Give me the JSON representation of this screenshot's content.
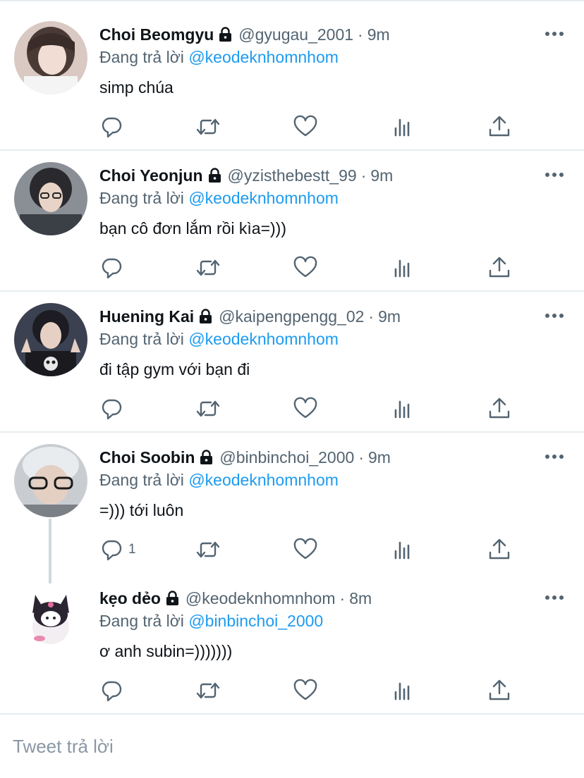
{
  "tweets": [
    {
      "name": "Choi Beomgyu",
      "handle": "@gyugau_2001",
      "time": "9m",
      "reply_prefix": "Đang trả lời",
      "reply_to": "@keodeknhomnhom",
      "text": "simp chúa",
      "reply_count": ""
    },
    {
      "name": "Choi Yeonjun",
      "handle": "@yzisthebestt_99",
      "time": "9m",
      "reply_prefix": "Đang trả lời",
      "reply_to": "@keodeknhomnhom",
      "text": "bạn cô đơn lắm rồi kìa=)))",
      "reply_count": ""
    },
    {
      "name": "Huening Kai",
      "handle": "@kaipengpengg_02",
      "time": "9m",
      "reply_prefix": "Đang trả lời",
      "reply_to": "@keodeknhomnhom",
      "text": "đi tập gym với bạn đi",
      "reply_count": ""
    },
    {
      "name": "Choi Soobin",
      "handle": "@binbinchoi_2000",
      "time": "9m",
      "reply_prefix": "Đang trả lời",
      "reply_to": "@keodeknhomnhom",
      "text": "=))) tới luôn",
      "reply_count": "1"
    },
    {
      "name": "kẹo dẻo",
      "handle": "@keodeknhomnhom",
      "time": "8m",
      "reply_prefix": "Đang trả lời",
      "reply_to": "@binbinchoi_2000",
      "text": "ơ anh subin=)))))))",
      "reply_count": ""
    }
  ],
  "separator": "·",
  "compose": {
    "placeholder": "Tweet trả lời"
  },
  "icons": {
    "lock": "lock-icon",
    "more": "more-icon",
    "reply": "reply-icon",
    "retweet": "retweet-icon",
    "like": "heart-icon",
    "views": "views-icon",
    "share": "share-icon"
  },
  "colors": {
    "text": "#0f1419",
    "secondary": "#536471",
    "accent": "#1d9bf0",
    "divider": "#e6ecf0"
  }
}
